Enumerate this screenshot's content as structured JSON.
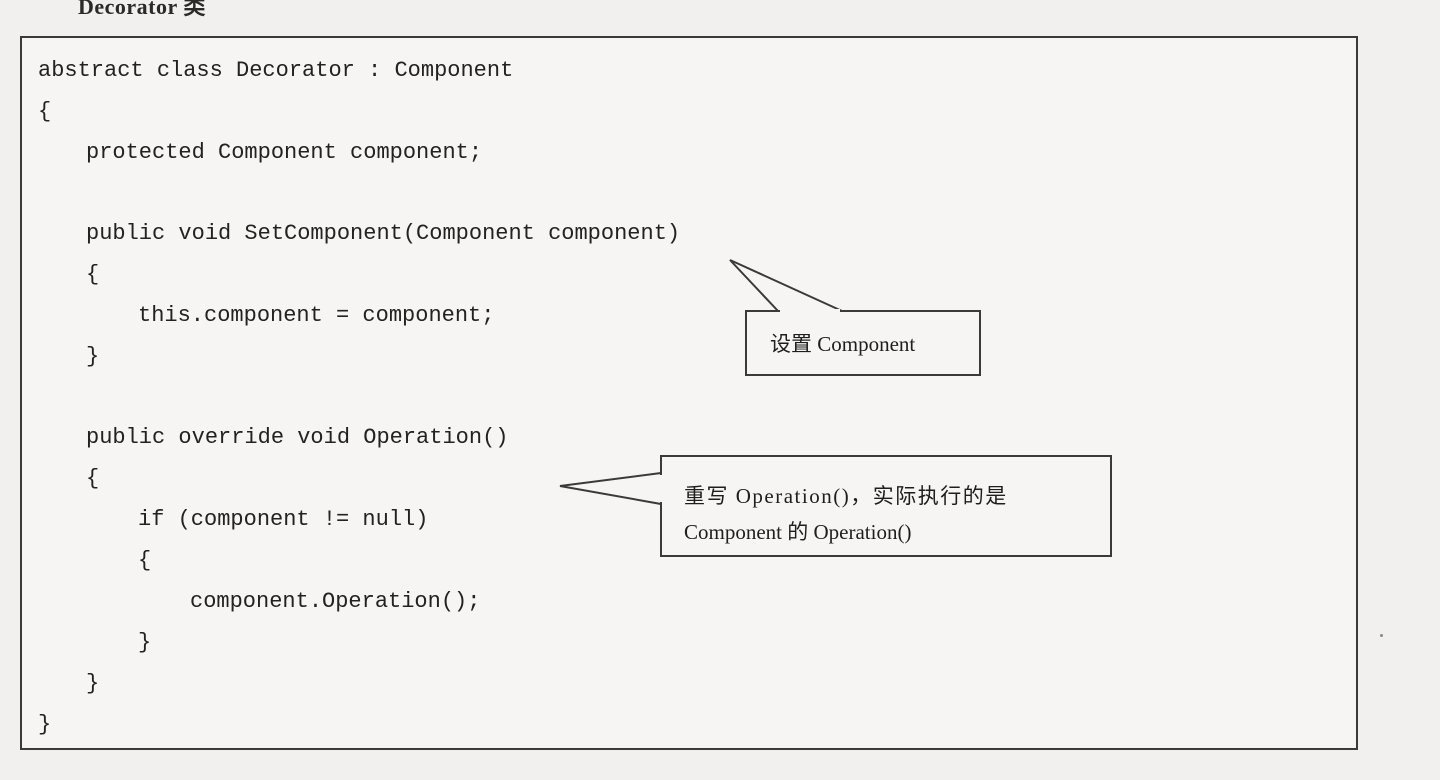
{
  "heading": "Decorator 类",
  "code": {
    "lines": [
      "abstract class Decorator : Component",
      "{",
      "protected Component component;",
      "public void SetComponent(Component component)",
      "{",
      "this.component = component;",
      "}",
      "public override void Operation()",
      "{",
      "if (component != null)",
      "{",
      "component.Operation();",
      "}",
      "}",
      "}"
    ]
  },
  "callouts": [
    {
      "text": "设置 Component"
    },
    {
      "line1": "重写 Operation()，实际执行的是",
      "line2": "Component 的 Operation()"
    }
  ]
}
